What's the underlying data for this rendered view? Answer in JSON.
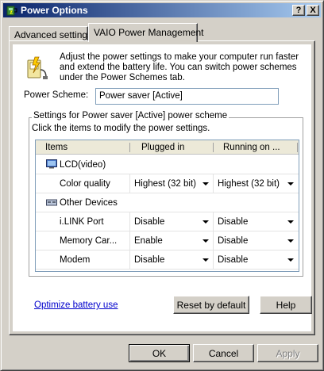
{
  "window": {
    "title": "Power Options",
    "help_button": "?",
    "close_button": "X"
  },
  "tabs": [
    {
      "label": "Advanced settings",
      "selected": false
    },
    {
      "label": "VAIO Power Management",
      "selected": true
    }
  ],
  "description": "Adjust the power settings to make your computer run faster and extend the battery life. You can switch power schemes under the Power Schemes tab.",
  "power_scheme": {
    "label": "Power Scheme:",
    "value": "Power saver [Active]"
  },
  "settings_group": {
    "title": "Settings for Power saver [Active] power scheme",
    "instruction": "Click the items to modify the power settings."
  },
  "grid": {
    "columns": [
      "Items",
      "Plugged in",
      "Running on ..."
    ],
    "categories": [
      {
        "name": "LCD(video)",
        "icon": "monitor-icon",
        "items": [
          {
            "name": "Color quality",
            "plugged_in": "Highest (32 bit)",
            "battery": "Highest (32 bit)"
          }
        ]
      },
      {
        "name": "Other Devices",
        "icon": "device-icon",
        "items": [
          {
            "name": "i.LINK Port",
            "plugged_in": "Disable",
            "battery": "Disable"
          },
          {
            "name": "Memory Car...",
            "plugged_in": "Enable",
            "battery": "Disable"
          },
          {
            "name": "Modem",
            "plugged_in": "Disable",
            "battery": "Disable"
          }
        ]
      }
    ]
  },
  "links": {
    "optimize": "Optimize battery use"
  },
  "buttons": {
    "reset": "Reset by default",
    "help": "Help",
    "ok": "OK",
    "cancel": "Cancel",
    "apply": "Apply"
  },
  "colors": {
    "titlebar_start": "#0a246a",
    "titlebar_end": "#a6caf0",
    "dialog_face": "#d4d0c8",
    "link": "#0000cc"
  }
}
